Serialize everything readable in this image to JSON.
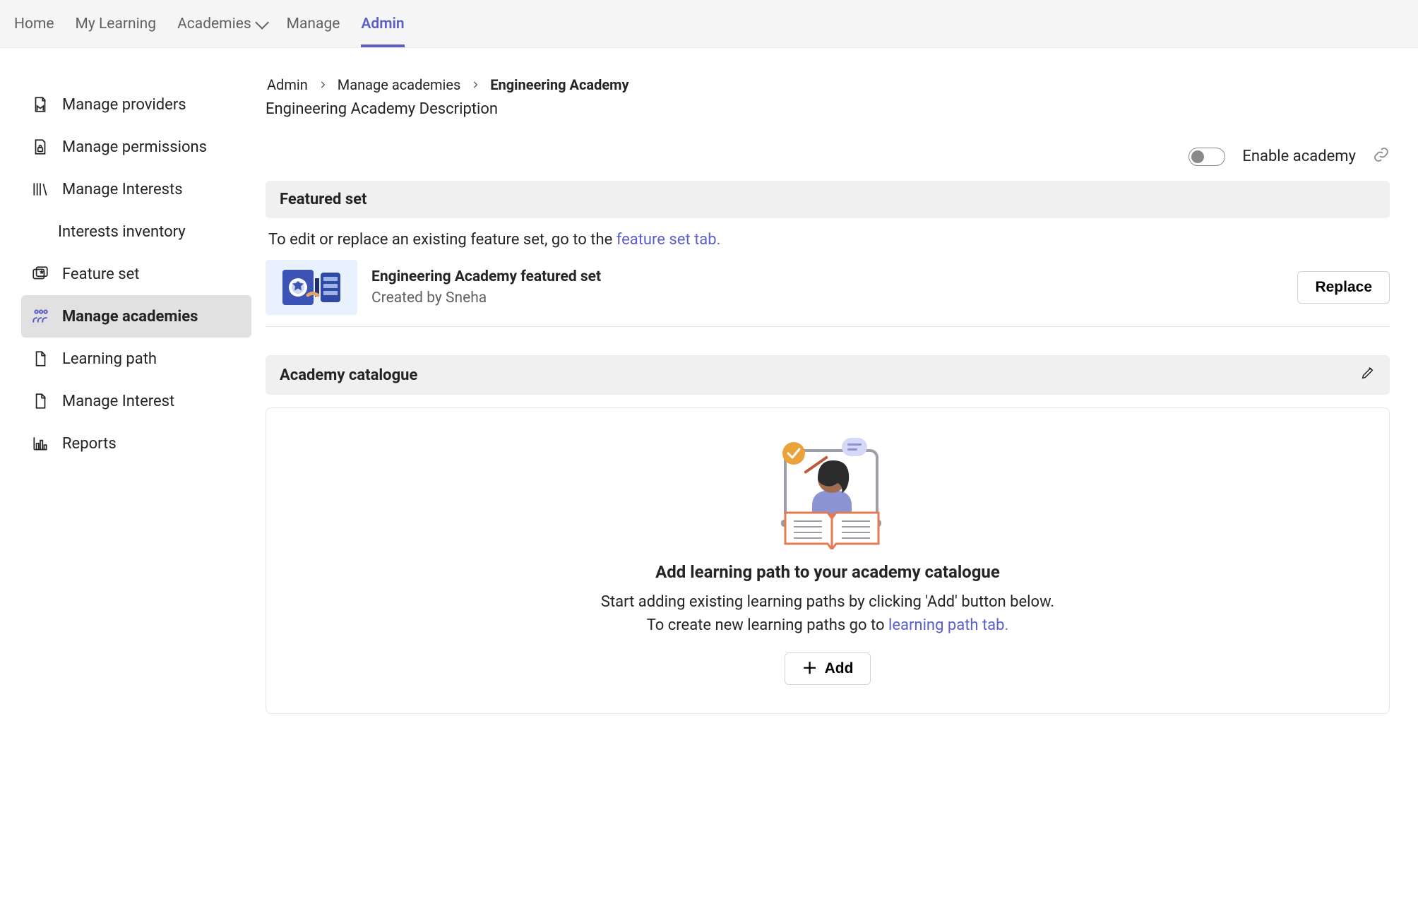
{
  "topnav": {
    "items": [
      {
        "label": "Home"
      },
      {
        "label": "My Learning"
      },
      {
        "label": "Academies",
        "hasDropdown": true
      },
      {
        "label": "Manage"
      },
      {
        "label": "Admin",
        "active": true
      }
    ]
  },
  "sidebar": {
    "items": [
      {
        "label": "Manage providers",
        "icon": "provider-icon"
      },
      {
        "label": "Manage permissions",
        "icon": "lock-file-icon"
      },
      {
        "label": "Manage Interests",
        "icon": "books-icon"
      },
      {
        "label": "Interests inventory",
        "icon": null
      },
      {
        "label": "Feature set",
        "icon": "star-card-icon"
      },
      {
        "label": "Manage academies",
        "icon": "people-icon",
        "selected": true
      },
      {
        "label": "Learning path",
        "icon": "document-icon"
      },
      {
        "label": "Manage Interest",
        "icon": "document-icon"
      },
      {
        "label": "Reports",
        "icon": "chart-icon"
      }
    ]
  },
  "breadcrumb": {
    "items": [
      {
        "label": "Admin"
      },
      {
        "label": "Manage academies"
      },
      {
        "label": "Engineering Academy",
        "current": true
      }
    ]
  },
  "subtitle": "Engineering Academy Description",
  "enable": {
    "label": "Enable academy",
    "value": false
  },
  "featured": {
    "header": "Featured set",
    "helper_prefix": "To edit or replace an existing feature set, go to the ",
    "helper_link": "feature set tab.",
    "set_title": "Engineering Academy featured set",
    "set_creator": "Created by Sneha",
    "replace_label": "Replace"
  },
  "catalogue": {
    "header": "Academy catalogue",
    "title": "Add learning path to your academy catalogue",
    "line1": "Start adding existing learning paths by clicking 'Add' button below.",
    "line2_prefix": "To create new learning paths go to ",
    "line2_link": "learning path tab.",
    "add_label": "Add"
  }
}
